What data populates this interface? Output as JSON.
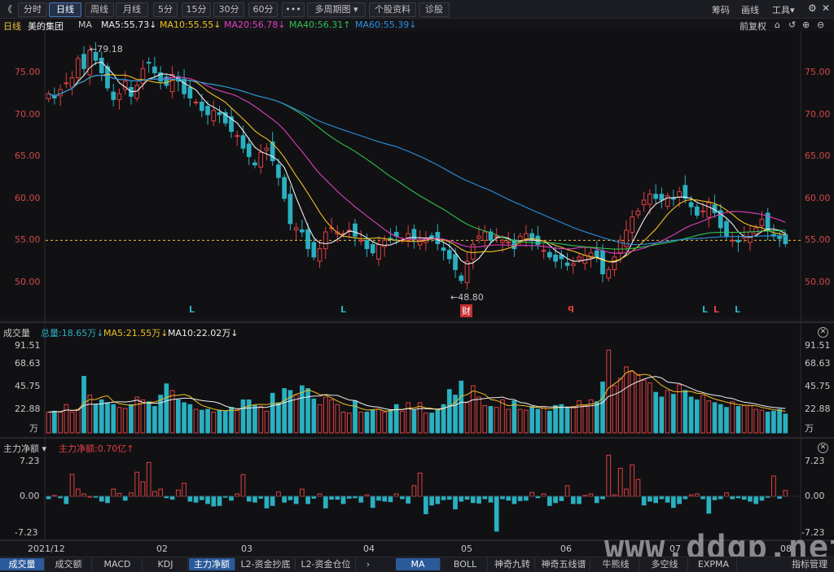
{
  "toolbar": {
    "back_glyph": "《",
    "periods": [
      "分时",
      "日线",
      "周线",
      "月线",
      "5分",
      "15分",
      "30分",
      "60分"
    ],
    "active_period": "日线",
    "more": "•••",
    "multi_period": "多周期图",
    "stock_info": "个股资料",
    "diagnose": "诊股",
    "right": [
      "筹码",
      "画线",
      "工具"
    ],
    "window_icons": [
      "gear-icon",
      "minimize-icon",
      "close-icon"
    ]
  },
  "main_legend": {
    "period": "日线",
    "stock": "美的集团",
    "indicator": "MA",
    "ma5": "MA5:55.73↓",
    "ma10": "MA10:55.55↓",
    "ma20": "MA20:56.78↓",
    "ma40": "MA40:56.31↑",
    "ma60": "MA60:55.39↓",
    "adjust": "前复权",
    "colors": {
      "ma5": "#f0f0f0",
      "ma10": "#f0c020",
      "ma20": "#e040c0",
      "ma40": "#30c050",
      "ma60": "#2a90e0"
    }
  },
  "main_axis": {
    "ticks": [
      "75.00",
      "70.00",
      "65.00",
      "60.00",
      "55.00",
      "50.00"
    ],
    "high_label": "79.18",
    "low_label": "48.80",
    "current_line": "55.00"
  },
  "markers": {
    "L": "L",
    "q": "q",
    "cai": "财"
  },
  "volume": {
    "title": "成交量",
    "total": "总量:18.65万↓",
    "ma5": "MA5:21.55万↓",
    "ma10": "MA10:22.02万↓",
    "ticks": [
      "91.51",
      "68.63",
      "45.75",
      "22.88"
    ],
    "unit": "万"
  },
  "flow": {
    "title": "主力净额",
    "value": "主力净额:0.70亿↑",
    "ticks": [
      "7.23",
      "0.00",
      "-7.23"
    ]
  },
  "dates": [
    "2021/12",
    "02",
    "03",
    "04",
    "05",
    "06",
    "07",
    "08"
  ],
  "bottom_left_tabs": [
    "成交量",
    "成交额",
    "MACD",
    "KDJ",
    "主力净额",
    "L2-资金抄底",
    "L2-资金仓位"
  ],
  "bottom_left_active": "成交量",
  "bottom_left_selected": "主力净额",
  "bottom_right_tabs": [
    "MA",
    "BOLL",
    "神奇九转",
    "神奇五线谱",
    "牛熊线",
    "多空线",
    "EXPMA"
  ],
  "bottom_right_active": "MA",
  "bottom_right_end": "指标管理",
  "watermark": "www.ddgp.net",
  "chart_data": {
    "type": "candlestick",
    "price_range": [
      48.8,
      79.18
    ],
    "closes": [
      72.5,
      72,
      73,
      73.8,
      74.4,
      76.7,
      75.5,
      77.7,
      76.5,
      75,
      73.2,
      71.8,
      72.5,
      74,
      72.2,
      73.5,
      75.5,
      76.2,
      75,
      74,
      73.5,
      74.8,
      74,
      72.5,
      72,
      71.5,
      70.5,
      70,
      70.5,
      70,
      69,
      68,
      67.5,
      66,
      65,
      64,
      65.5,
      66,
      64.5,
      62.5,
      60,
      57,
      56.5,
      56,
      54,
      53,
      54,
      56,
      56.5,
      56,
      55.8,
      56.2,
      55.5,
      55,
      54,
      53.5,
      54.5,
      55,
      55.2,
      55.5,
      55,
      55.8,
      55.2,
      55,
      55.3,
      55.2,
      54.6,
      53.8,
      52.8,
      51.5,
      50.2,
      52.5,
      54.5,
      55.5,
      56,
      55,
      55.5,
      55,
      54.8,
      54,
      55.5,
      55.8,
      55,
      54.5,
      53.8,
      53,
      52.5,
      52.8,
      52,
      52.2,
      53,
      53.2,
      53.5,
      53,
      51,
      51.5,
      53,
      55,
      56.2,
      57.8,
      58.5,
      59.8,
      60.5,
      60,
      59.8,
      60.3,
      59.9,
      60.8,
      60,
      59,
      58,
      58.5,
      59.5,
      58.3,
      56.5,
      55.5,
      55,
      54.8,
      55.5,
      56,
      56.5,
      57.5,
      56.2,
      55.5,
      55.2,
      54.6
    ],
    "volume_wan": [
      22,
      23,
      22,
      30,
      22,
      25,
      60,
      40,
      30,
      35,
      32,
      30,
      27,
      26,
      30,
      38,
      35,
      33,
      28,
      40,
      52,
      45,
      35,
      32,
      30,
      25,
      24,
      25,
      22,
      24,
      23,
      27,
      24,
      35,
      35,
      29,
      28,
      23,
      42,
      32,
      47,
      45,
      40,
      50,
      47,
      36,
      30,
      38,
      35,
      30,
      22,
      21,
      34,
      22,
      22,
      24,
      25,
      22,
      24,
      30,
      23,
      32,
      24,
      32,
      21,
      21,
      24,
      30,
      46,
      40,
      55,
      32,
      50,
      38,
      29,
      28,
      27,
      35,
      25,
      34,
      25,
      24,
      28,
      25,
      28,
      23,
      29,
      30,
      27,
      28,
      34,
      29,
      35,
      33,
      54,
      88,
      50,
      58,
      70,
      65,
      62,
      56,
      53,
      43,
      38,
      45,
      41,
      51,
      45,
      38,
      35,
      40,
      34,
      32,
      30,
      27,
      33,
      28,
      29,
      29,
      25,
      24,
      22,
      23,
      25,
      20
    ],
    "main_net_yi": [
      -0.5,
      0.2,
      -0.3,
      -1.5,
      4.5,
      1.5,
      0.5,
      0,
      -0.2,
      -1,
      -1.3,
      1.5,
      0.6,
      -0.8,
      0.7,
      5,
      3,
      7,
      1,
      1.5,
      -0.3,
      -0.6,
      1.3,
      2.7,
      -1,
      -1.2,
      -0.7,
      -1.5,
      -2,
      -1.9,
      -0.2,
      -0.8,
      0.5,
      4.5,
      -1,
      -1.2,
      -0.4,
      -2.4,
      -1.9,
      0.9,
      -1.2,
      -0.7,
      -1.5,
      1.5,
      -1.5,
      -0.4,
      0.5,
      -2.4,
      -0.6,
      -0.6,
      -1.5,
      -0.4,
      -0.3,
      -1.2,
      0.3,
      -2.3,
      -0.8,
      -1,
      -1.1,
      0.5,
      -0.5,
      -1.4,
      2.2,
      4.8,
      -3.6,
      -1.8,
      -1.5,
      -0.7,
      -0.6,
      -2.6,
      -1,
      -0.6,
      -1.3,
      -1.4,
      -0.5,
      -1.2,
      -7.2,
      -0.5,
      -0.8,
      -1.5,
      -0.9,
      -0.8,
      0.8,
      -0.3,
      0.5,
      -1.9,
      -1.3,
      -0.9,
      2.2,
      -1.5,
      -1.5,
      0.2,
      0.5,
      -1.3,
      -0.5,
      8.5,
      0.3,
      5.8,
      1.5,
      6.5,
      3.5,
      -1.8,
      -1,
      -1.3,
      -0.5,
      -1.2,
      -2.3,
      -1.5,
      -0.5,
      0.3,
      0.5,
      -0.5,
      -3.5,
      -0.7,
      -0.5,
      0.7,
      -0.5,
      -0.3,
      -0.6,
      -1,
      -1.5,
      -0.8,
      -0.2,
      4.2,
      -0.4,
      1.2
    ]
  }
}
